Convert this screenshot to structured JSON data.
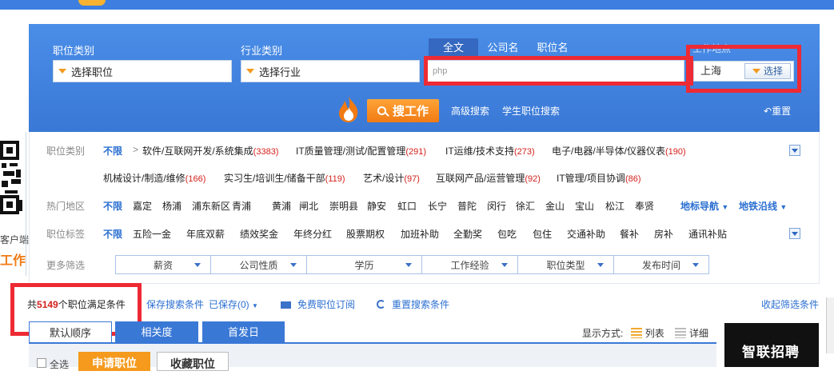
{
  "search_panel": {
    "job_category_label": "职位类别",
    "job_category_value": "选择职位",
    "industry_label": "行业类别",
    "industry_value": "选择行业",
    "tabs": [
      {
        "label": "全文",
        "active": true
      },
      {
        "label": "公司名",
        "active": false
      },
      {
        "label": "职位名",
        "active": false
      }
    ],
    "keyword_value": "php",
    "work_location_label": "工作地点",
    "city_value": "上海",
    "city_button": "选择",
    "search_button": "搜工作",
    "advanced_search": "高级搜索",
    "student_search": "学生职位搜索",
    "reset": "重置"
  },
  "filters": {
    "category": {
      "label": "职位类别",
      "unlimited": "不限",
      "items": [
        {
          "name": "软件/互联网开发/系统集成",
          "count": "(3383)"
        },
        {
          "name": "IT质量管理/测试/配置管理",
          "count": "(291)"
        },
        {
          "name": "IT运维/技术支持",
          "count": "(273)"
        },
        {
          "name": "电子/电器/半导体/仪器仪表",
          "count": "(190)"
        },
        {
          "name": "机械设计/制造/维修",
          "count": "(166)"
        },
        {
          "name": "实习生/培训生/储备干部",
          "count": "(119)"
        },
        {
          "name": "艺术/设计",
          "count": "(97)"
        },
        {
          "name": "互联网产品/运营管理",
          "count": "(92)"
        },
        {
          "name": "IT管理/项目协调",
          "count": "(86)"
        }
      ]
    },
    "area": {
      "label": "热门地区",
      "unlimited": "不限",
      "items": [
        "嘉定",
        "杨浦",
        "浦东新区",
        "青浦",
        "黄浦",
        "闸北",
        "崇明县",
        "静安",
        "虹口",
        "长宁",
        "普陀",
        "闵行",
        "徐汇",
        "金山",
        "宝山",
        "松江",
        "奉贤"
      ],
      "nav_landmark": "地标导航",
      "nav_metro": "地铁沿线"
    },
    "tags": {
      "label": "职位标签",
      "unlimited": "不限",
      "items": [
        "五险一金",
        "年底双薪",
        "绩效奖金",
        "年终分红",
        "股票期权",
        "加班补助",
        "全勤奖",
        "包吃",
        "包住",
        "交通补助",
        "餐补",
        "房补",
        "通讯补贴"
      ]
    },
    "more": {
      "label": "更多筛选",
      "dropdowns": [
        "薪资",
        "公司性质",
        "学历",
        "工作经验",
        "职位类型",
        "发布时间"
      ]
    }
  },
  "side": {
    "client_text": "客户端",
    "big_text": "工作"
  },
  "results": {
    "summary_prefix": "共",
    "summary_count": "5149",
    "summary_suffix": "个职位满足条件",
    "save_search": "保存搜索条件",
    "saved": "已保存",
    "saved_count": "(0)",
    "subscribe": "免费职位订阅",
    "reset_search": "重置搜索条件",
    "collapse_filters": "收起筛选条件",
    "sort_tabs": [
      "默认顺序",
      "相关度",
      "首发日"
    ],
    "display_mode_label": "显示方式:",
    "display_list": "列表",
    "display_detail": "详细",
    "select_all": "全选",
    "apply_button": "申请职位",
    "favorite_button": "收藏职位"
  },
  "ad": {
    "text": "智联招聘"
  },
  "colors": {
    "brand_blue": "#3a78d6",
    "accent_orange": "#f07a13",
    "count_red": "#d4211c",
    "highlight_red": "#ee2a34"
  }
}
